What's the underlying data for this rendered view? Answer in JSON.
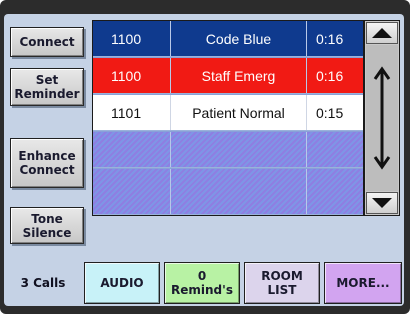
{
  "side_buttons": [
    {
      "label": "Connect"
    },
    {
      "label": "Set\nReminder"
    },
    {
      "label": "Enhance\nConnect"
    },
    {
      "label": "Tone\nSilence"
    }
  ],
  "calls": [
    {
      "room": "1100",
      "type": "Code Blue",
      "time": "0:16",
      "status": "blue"
    },
    {
      "room": "1100",
      "type": "Staff Emerg",
      "time": "0:16",
      "status": "red"
    },
    {
      "room": "1101",
      "type": "Patient Normal",
      "time": "0:15",
      "status": "white"
    }
  ],
  "bottom": {
    "call_count": "3 Calls",
    "tabs": [
      {
        "label": "AUDIO",
        "color": "#c8f2f8"
      },
      {
        "label": "0\nRemind's",
        "color": "#b8f2a4"
      },
      {
        "label": "ROOM\nLIST",
        "color": "#dcd4ec"
      },
      {
        "label": "MORE...",
        "color": "#d2a4f0"
      }
    ]
  },
  "scrollbar": {
    "up_icon": "triangle-up-icon",
    "down_icon": "triangle-down-icon",
    "track_icon": "vertical-double-arrow-icon"
  }
}
